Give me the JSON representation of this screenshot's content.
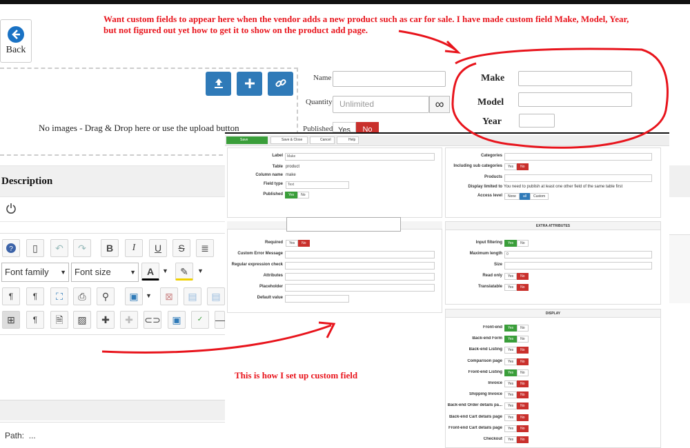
{
  "back": {
    "label": "Back"
  },
  "note_top": [
    "Want custom fields to appear here when the vendor adds a new product such as car for sale. I have made custom field Make, Model, Year,",
    "but not figured out yet how to get it to show on the product add page."
  ],
  "note_bottom": "This is how I set up custom field",
  "dropzone": {
    "text": "No images - Drag & Drop here or use the upload button"
  },
  "product_form": {
    "name_label": "Name",
    "quantity_label": "Quantity",
    "quantity_placeholder": "Unlimited",
    "infinity": "∞",
    "published_label": "Published",
    "published_yes": "Yes",
    "published_no": "No"
  },
  "custom": {
    "make": "Make",
    "model": "Model",
    "year": "Year"
  },
  "description": {
    "title": "Description"
  },
  "editor": {
    "font_family": "Font family",
    "font_size": "Font size",
    "bold": "B",
    "italic": "I",
    "underline": "U",
    "strike": "S",
    "pilcrow": "¶",
    "path_label": "Path:",
    "path_value": "..."
  },
  "admin": {
    "toolbar": {
      "save": "Save",
      "save_close": "Save & Close",
      "cancel": "Cancel",
      "help": "Help"
    },
    "left": {
      "label_lbl": "Label",
      "label_val": "Make",
      "table_lbl": "Table",
      "table_val": "product",
      "col_lbl": "Column name",
      "col_val": "make",
      "ftype_lbl": "Field type",
      "ftype_val": "Text",
      "pub_lbl": "Published"
    },
    "right": {
      "cat_lbl": "Categories",
      "incl_lbl": "Including sub categories",
      "prod_lbl": "Products",
      "disp_lbl": "Display limited to",
      "disp_val": "You need to publish at least one other field of the same table first",
      "access_lbl": "Access level",
      "acc_none": "None",
      "acc_all": "all",
      "acc_custom": "Custom"
    },
    "left2": {
      "req": "Required",
      "err": "Custom Error Message",
      "regex": "Regular expression check",
      "attr": "Attributes",
      "ph": "Placeholder",
      "def": "Default value"
    },
    "extra": {
      "title": "EXTRA ATTRIBUTES",
      "filter": "Input filtering",
      "maxlen": "Maximum length",
      "maxlen_val": "0",
      "size": "Size",
      "readonly": "Read only",
      "translatable": "Translatable"
    },
    "display": {
      "title": "DISPLAY",
      "rows": [
        "Front-end",
        "Back-end Form",
        "Back-end Listing",
        "Comparison page",
        "Front-end Listing",
        "Invoice",
        "Shipping Invoice",
        "Back-end Order details pa...",
        "Back-end Cart details page",
        "Front-end Cart details page",
        "Checkout"
      ],
      "yes_on": [
        true,
        true,
        false,
        false,
        true,
        false,
        false,
        false,
        false,
        false,
        false
      ],
      "yes": "Yes",
      "no": "No"
    }
  }
}
